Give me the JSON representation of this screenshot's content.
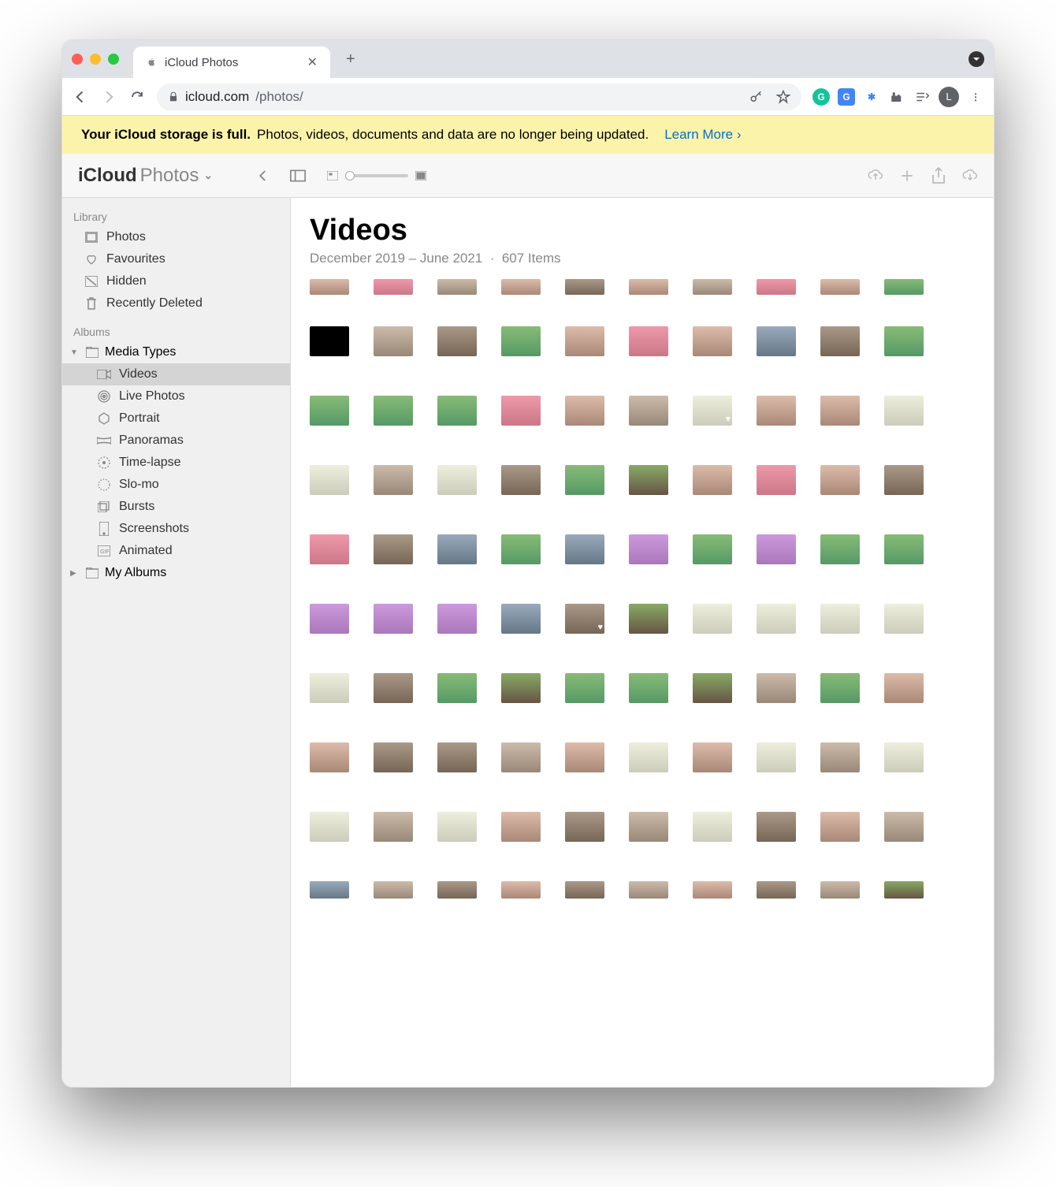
{
  "browser": {
    "tab_title": "iCloud Photos",
    "url_domain": "icloud.com",
    "url_path": "/photos/",
    "profile_letter": "L"
  },
  "banner": {
    "bold": "Your iCloud storage is full.",
    "text": "Photos, videos, documents and data are no longer being updated.",
    "learn": "Learn More"
  },
  "brand": {
    "a": "iCloud",
    "b": "Photos"
  },
  "sidebar": {
    "library_label": "Library",
    "library": [
      "Photos",
      "Favourites",
      "Hidden",
      "Recently Deleted"
    ],
    "albums_label": "Albums",
    "media_types_label": "Media Types",
    "media_types": [
      "Videos",
      "Live Photos",
      "Portrait",
      "Panoramas",
      "Time-lapse",
      "Slo-mo",
      "Bursts",
      "Screenshots",
      "Animated"
    ],
    "my_albums_label": "My Albums"
  },
  "main": {
    "title": "Videos",
    "date_range": "December 2019 – June 2021",
    "count": "607 Items"
  }
}
